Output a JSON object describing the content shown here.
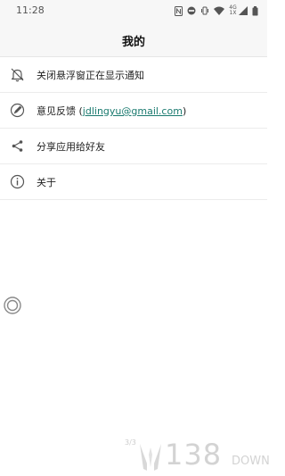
{
  "status_bar": {
    "time": "11:28",
    "network_label_top": "4G",
    "network_label_bottom": "1X",
    "icons": [
      "nfc-icon",
      "do-not-disturb-icon",
      "vibrate-icon",
      "wifi-icon",
      "cellular-signal-icon",
      "battery-icon"
    ]
  },
  "header": {
    "title": "我的"
  },
  "menu": {
    "items": [
      {
        "name": "disable-floating-window-notification",
        "icon": "bell-off-icon",
        "label": "关闭悬浮窗正在显示通知"
      },
      {
        "name": "feedback",
        "icon": "pen-icon",
        "label_prefix": "意见反馈 (",
        "email": "jdlingyu@gmail.com",
        "label_suffix": ")"
      },
      {
        "name": "share-app",
        "icon": "share-icon",
        "label": "分享应用给好友"
      },
      {
        "name": "about",
        "icon": "info-icon",
        "label": "关于"
      }
    ]
  },
  "floating_ball": {
    "icon": "floating-ball-icon"
  },
  "page_indicator": "3/3",
  "watermark": {
    "logo": "138down-logo",
    "text": "138",
    "subtext": "DOWN"
  },
  "colors": {
    "background": "#ffffff",
    "header_bg": "#f7f7f7",
    "link": "#1a7a6f"
  }
}
